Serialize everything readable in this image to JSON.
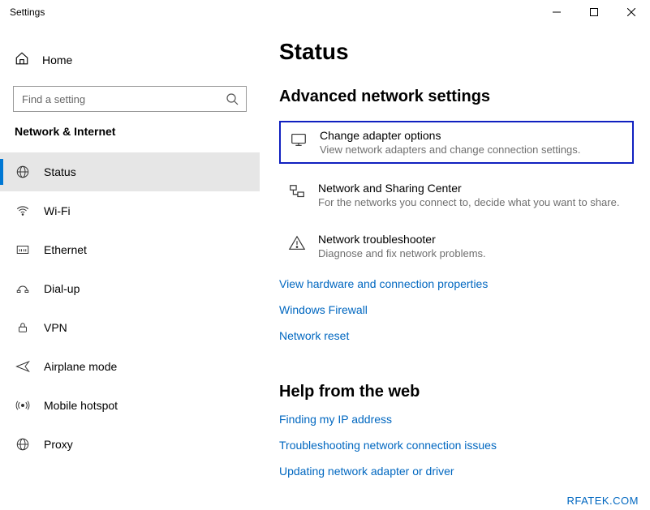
{
  "window": {
    "title": "Settings"
  },
  "sidebar": {
    "home_label": "Home",
    "search_placeholder": "Find a setting",
    "category": "Network & Internet",
    "items": [
      {
        "label": "Status"
      },
      {
        "label": "Wi-Fi"
      },
      {
        "label": "Ethernet"
      },
      {
        "label": "Dial-up"
      },
      {
        "label": "VPN"
      },
      {
        "label": "Airplane mode"
      },
      {
        "label": "Mobile hotspot"
      },
      {
        "label": "Proxy"
      }
    ]
  },
  "main": {
    "title": "Status",
    "section_advanced": "Advanced network settings",
    "options": [
      {
        "title": "Change adapter options",
        "desc": "View network adapters and change connection settings."
      },
      {
        "title": "Network and Sharing Center",
        "desc": "For the networks you connect to, decide what you want to share."
      },
      {
        "title": "Network troubleshooter",
        "desc": "Diagnose and fix network problems."
      }
    ],
    "links": [
      "View hardware and connection properties",
      "Windows Firewall",
      "Network reset"
    ],
    "section_help": "Help from the web",
    "help_links": [
      "Finding my IP address",
      "Troubleshooting network connection issues",
      "Updating network adapter or driver"
    ],
    "watermark": "RFATEK.COM"
  }
}
